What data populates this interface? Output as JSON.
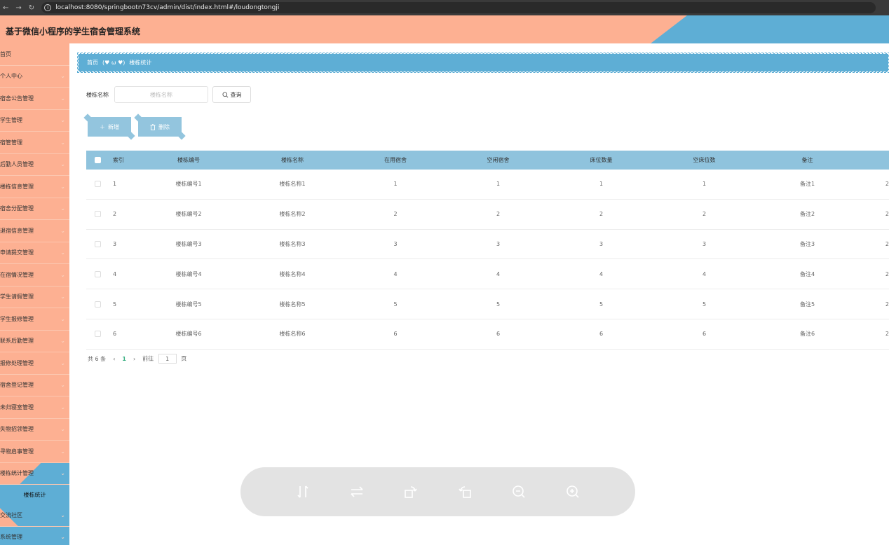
{
  "browser": {
    "url": "localhost:8080/springbootn73cv/admin/dist/index.html#/loudongtongji"
  },
  "header": {
    "title": "基于微信小程序的学生宿舍管理系统"
  },
  "sidebar": {
    "items": [
      {
        "label": "首页"
      },
      {
        "label": "个人中心"
      },
      {
        "label": "宿舍公告管理"
      },
      {
        "label": "学生管理"
      },
      {
        "label": "宿管管理"
      },
      {
        "label": "后勤人员管理"
      },
      {
        "label": "楼栋信息管理"
      },
      {
        "label": "宿舍分配管理"
      },
      {
        "label": "退宿信息管理"
      },
      {
        "label": "申请提交管理"
      },
      {
        "label": "在宿情况管理"
      },
      {
        "label": "学生请假管理"
      },
      {
        "label": "学生报修管理"
      },
      {
        "label": "联系后勤管理"
      },
      {
        "label": "报修处理管理"
      },
      {
        "label": "宿舍登记管理"
      },
      {
        "label": "未归寝室管理"
      },
      {
        "label": "失物招领管理"
      },
      {
        "label": "寻物启事管理"
      },
      {
        "label": "楼栋统计管理"
      }
    ],
    "sub_item": "楼栋统计",
    "bottom_items": [
      {
        "label": "交流社区"
      },
      {
        "label": "系统管理"
      }
    ]
  },
  "breadcrumb": {
    "home": "首页",
    "sep": "(♥ ω ♥)",
    "current": "楼栋统计"
  },
  "search": {
    "label": "楼栋名称",
    "placeholder": "楼栋名称",
    "button": "查询"
  },
  "actions": {
    "add": "新增",
    "delete": "删除"
  },
  "table": {
    "headers": [
      "索引",
      "楼栋编号",
      "楼栋名称",
      "在用宿舍",
      "空闲宿舍",
      "床位数量",
      "空床位数",
      "备注"
    ],
    "rows": [
      [
        "1",
        "楼栋编号1",
        "楼栋名称1",
        "1",
        "1",
        "1",
        "1",
        "备注1",
        "2"
      ],
      [
        "2",
        "楼栋编号2",
        "楼栋名称2",
        "2",
        "2",
        "2",
        "2",
        "备注2",
        "2"
      ],
      [
        "3",
        "楼栋编号3",
        "楼栋名称3",
        "3",
        "3",
        "3",
        "3",
        "备注3",
        "2"
      ],
      [
        "4",
        "楼栋编号4",
        "楼栋名称4",
        "4",
        "4",
        "4",
        "4",
        "备注4",
        "2"
      ],
      [
        "5",
        "楼栋编号5",
        "楼栋名称5",
        "5",
        "5",
        "5",
        "5",
        "备注5",
        "2"
      ],
      [
        "6",
        "楼栋编号6",
        "楼栋名称6",
        "6",
        "6",
        "6",
        "6",
        "备注6",
        "2"
      ]
    ]
  },
  "pager": {
    "total": "共 6 条",
    "current": "1",
    "goto": "前往",
    "page_value": "1",
    "page_unit": "页"
  },
  "viewer": {
    "icons": [
      "flip-vertical-icon",
      "flip-horizontal-icon",
      "rotate-right-icon",
      "rotate-left-icon",
      "zoom-out-icon",
      "zoom-in-icon"
    ]
  },
  "colors": {
    "salmon": "#fdb092",
    "blue": "#5eaed5",
    "table_head": "#8fc3dd"
  }
}
